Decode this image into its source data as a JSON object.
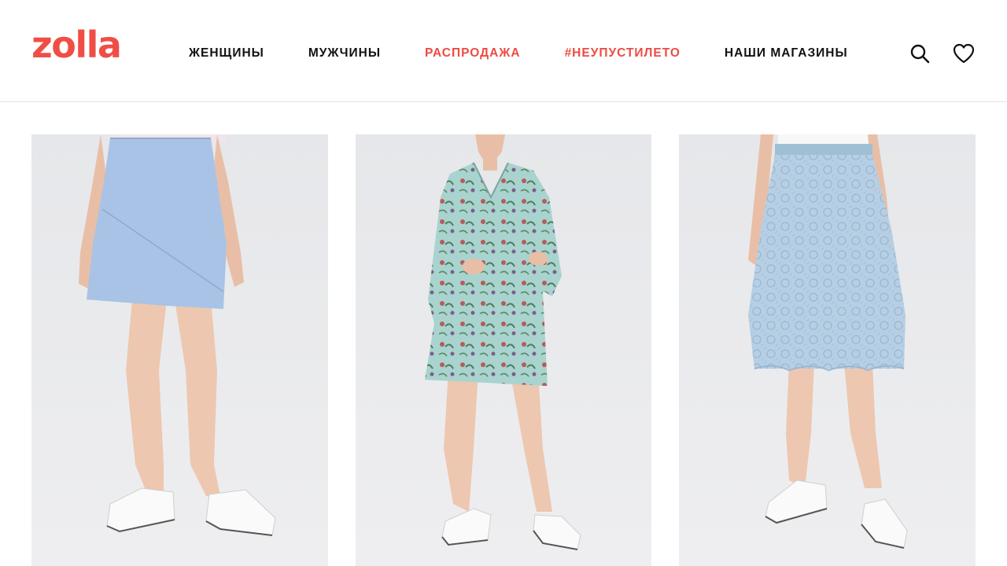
{
  "brand": {
    "logo_text": "zolla",
    "accent_color": "#f04e45"
  },
  "nav": {
    "items": [
      {
        "label": "ЖЕНЩИНЫ",
        "accent": false
      },
      {
        "label": "МУЖЧИНЫ",
        "accent": false
      },
      {
        "label": "РАСПРОДАЖА",
        "accent": true
      },
      {
        "label": "#НЕУПУСТИЛЕТО",
        "accent": true
      },
      {
        "label": "НАШИ МАГАЗИНЫ",
        "accent": false
      }
    ]
  },
  "actions": {
    "search_icon": "search-icon",
    "favorites_icon": "heart-icon"
  },
  "products": [
    {
      "image": "model-light-blue-a-line-skirt",
      "color": "#a9c3e6"
    },
    {
      "image": "model-floral-print-mint-dress",
      "color": "#a9d3cf"
    },
    {
      "image": "model-light-blue-lace-skirt",
      "color": "#b7cfe4"
    }
  ]
}
